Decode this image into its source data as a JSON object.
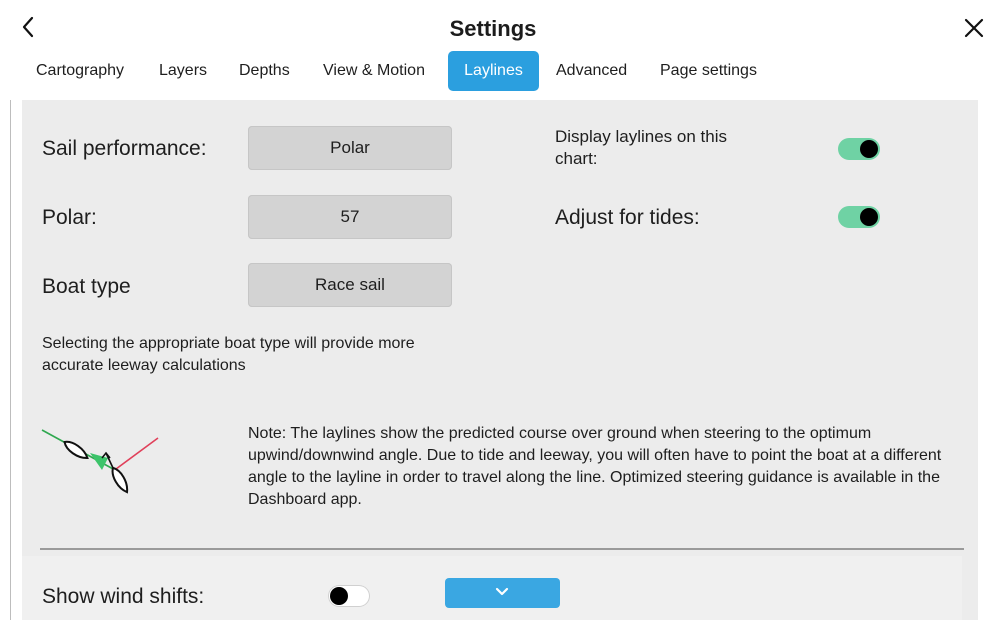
{
  "header": {
    "title": "Settings",
    "tabs": [
      {
        "label": "Cartography"
      },
      {
        "label": "Layers"
      },
      {
        "label": "Depths"
      },
      {
        "label": "View & Motion"
      },
      {
        "label": "Laylines",
        "active": true
      },
      {
        "label": "Advanced"
      },
      {
        "label": "Page settings"
      }
    ]
  },
  "settings": {
    "sail_performance": {
      "label": "Sail performance:",
      "value": "Polar"
    },
    "polar": {
      "label": "Polar:",
      "value": "57"
    },
    "boat_type": {
      "label": "Boat type",
      "value": "Race sail"
    },
    "boat_type_info": "Selecting the appropriate boat type will provide more accurate leeway calculations",
    "display_laylines": {
      "label": "Display laylines on this chart:",
      "enabled": true
    },
    "adjust_tides": {
      "label": "Adjust for tides:",
      "enabled": true
    },
    "note": "Note:  The laylines show the predicted course over ground when steering to the optimum upwind/downwind angle. Due to tide and leeway, you will often have to point the boat at a different angle to the layline in order to travel along the line. Optimized steering guidance is available in the Dashboard app.",
    "wind_shifts": {
      "label": "Show wind shifts:",
      "enabled": false
    }
  },
  "icons": {
    "back": "chevron-left-icon",
    "close": "close-icon",
    "illustration": "layline-boats-icon",
    "expand": "chevron-down-icon"
  },
  "colors": {
    "accent": "#2b9fdf",
    "toggle_on": "#6fd2a4",
    "panel_bg": "#ececec",
    "button_bg": "#d3d3d3",
    "layline_green": "#2fa84f",
    "layline_red": "#e0405a"
  }
}
